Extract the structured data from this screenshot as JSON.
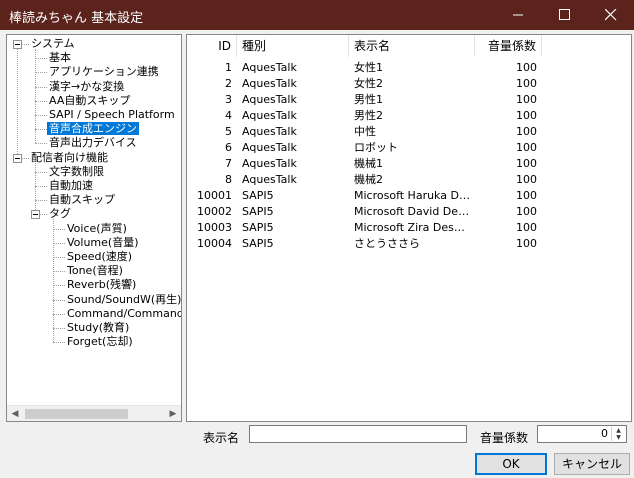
{
  "window": {
    "title": "棒読みちゃん 基本設定"
  },
  "tree": {
    "items": [
      {
        "label": "システム",
        "level": 0,
        "expanded": true
      },
      {
        "label": "基本",
        "level": 1
      },
      {
        "label": "アプリケーション連携",
        "level": 1
      },
      {
        "label": "漢字→かな変換",
        "level": 1
      },
      {
        "label": "AA自動スキップ",
        "level": 1
      },
      {
        "label": "SAPI / Speech Platform",
        "level": 1
      },
      {
        "label": "音声合成エンジン",
        "level": 1,
        "selected": true
      },
      {
        "label": "音声出力デバイス",
        "level": 1
      },
      {
        "label": "配信者向け機能",
        "level": 0,
        "expanded": true
      },
      {
        "label": "文字数制限",
        "level": 1
      },
      {
        "label": "自動加速",
        "level": 1
      },
      {
        "label": "自動スキップ",
        "level": 1
      },
      {
        "label": "タグ",
        "level": 1,
        "expanded": true
      },
      {
        "label": "Voice(声質)",
        "level": 2
      },
      {
        "label": "Volume(音量)",
        "level": 2
      },
      {
        "label": "Speed(速度)",
        "level": 2
      },
      {
        "label": "Tone(音程)",
        "level": 2
      },
      {
        "label": "Reverb(残響)",
        "level": 2
      },
      {
        "label": "Sound/SoundW(再生)",
        "level": 2
      },
      {
        "label": "Command/CommandW",
        "level": 2
      },
      {
        "label": "Study(教育)",
        "level": 2
      },
      {
        "label": "Forget(忘却)",
        "level": 2
      }
    ]
  },
  "voice_table": {
    "columns": [
      "ID",
      "種別",
      "表示名",
      "音量係数"
    ],
    "rows": [
      {
        "id": "1",
        "type": "AquesTalk",
        "name": "女性1",
        "volume": "100"
      },
      {
        "id": "2",
        "type": "AquesTalk",
        "name": "女性2",
        "volume": "100"
      },
      {
        "id": "3",
        "type": "AquesTalk",
        "name": "男性1",
        "volume": "100"
      },
      {
        "id": "4",
        "type": "AquesTalk",
        "name": "男性2",
        "volume": "100"
      },
      {
        "id": "5",
        "type": "AquesTalk",
        "name": "中性",
        "volume": "100"
      },
      {
        "id": "6",
        "type": "AquesTalk",
        "name": "ロボット",
        "volume": "100"
      },
      {
        "id": "7",
        "type": "AquesTalk",
        "name": "機械1",
        "volume": "100"
      },
      {
        "id": "8",
        "type": "AquesTalk",
        "name": "機械2",
        "volume": "100"
      },
      {
        "id": "10001",
        "type": "SAPI5",
        "name": "Microsoft Haruka De...",
        "volume": "100"
      },
      {
        "id": "10002",
        "type": "SAPI5",
        "name": "Microsoft David Des...",
        "volume": "100"
      },
      {
        "id": "10003",
        "type": "SAPI5",
        "name": "Microsoft Zira Deskt...",
        "volume": "100"
      },
      {
        "id": "10004",
        "type": "SAPI5",
        "name": "さとうささら",
        "volume": "100"
      }
    ]
  },
  "form": {
    "display_name_label": "表示名",
    "display_name_value": "",
    "volume_label": "音量係数",
    "volume_value": "0"
  },
  "buttons": {
    "ok": "OK",
    "cancel": "キャンセル"
  },
  "colors": {
    "titlebar": "#5b231c",
    "selection": "#0078d7"
  }
}
